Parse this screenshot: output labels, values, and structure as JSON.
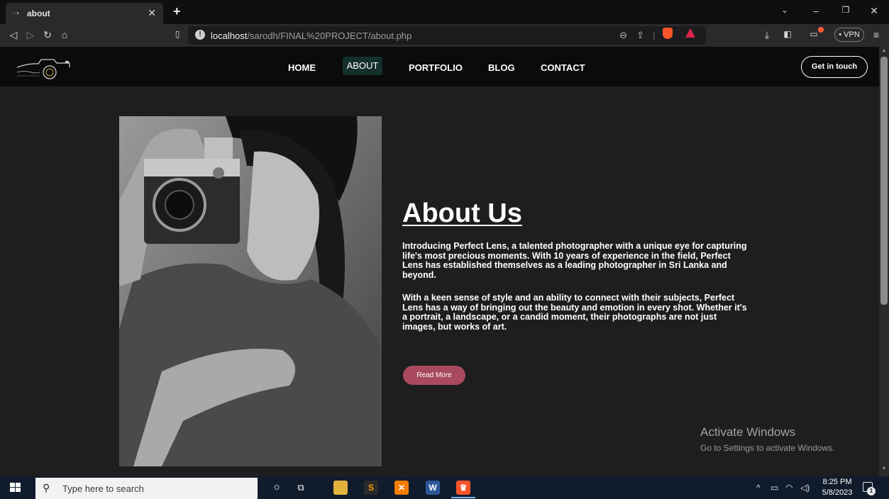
{
  "browser": {
    "tab_title": "about",
    "url_host": "localhost",
    "url_path": "/sarodh/FINAL%20PROJECT/about.php",
    "vpn_label": "• VPN",
    "icons": {
      "back": "back-arrow-icon",
      "forward": "forward-arrow-icon",
      "reload": "reload-icon",
      "home": "home-icon",
      "bookmark": "bookmark-icon",
      "site_info": "info-icon",
      "zoom": "zoom-icon",
      "share": "share-icon",
      "brave_shields": "brave-shields-icon",
      "brave_rewards": "brave-rewards-icon",
      "download": "download-icon",
      "sidebar": "sidebar-icon",
      "wallet": "wallet-icon",
      "menu": "hamburger-menu-icon"
    }
  },
  "site": {
    "nav": [
      "HOME",
      "ABOUT",
      "PORTFOLIO",
      "BLOG",
      "CONTACT"
    ],
    "active_nav": "ABOUT",
    "cta_label": "Get in touch",
    "about": {
      "title": "About Us",
      "paragraph1": "Introducing Perfect Lens, a talented photographer with a unique eye for capturing life's most precious moments. With 10 years of experience in the field, Perfect Lens has established themselves as a leading photographer in Sri Lanka and beyond.",
      "paragraph2": "With a keen sense of style and an ability to connect with their subjects, Perfect Lens has a way of bringing out the beauty and emotion in every shot. Whether it's a portrait, a landscape, or a candid moment, their photographs are not just images, but works of art.",
      "read_more_label": "Read More"
    },
    "colors": {
      "header_bg": "#0b0b0b",
      "page_bg": "#1e1e1e",
      "active_nav_bg": "#14302b",
      "read_more_bg": "#a94960"
    }
  },
  "watermark": {
    "title": "Activate Windows",
    "subtitle": "Go to Settings to activate Windows."
  },
  "taskbar": {
    "search_placeholder": "Type here to search",
    "time": "8:25 PM",
    "date": "5/8/2023",
    "notification_count": "1"
  }
}
